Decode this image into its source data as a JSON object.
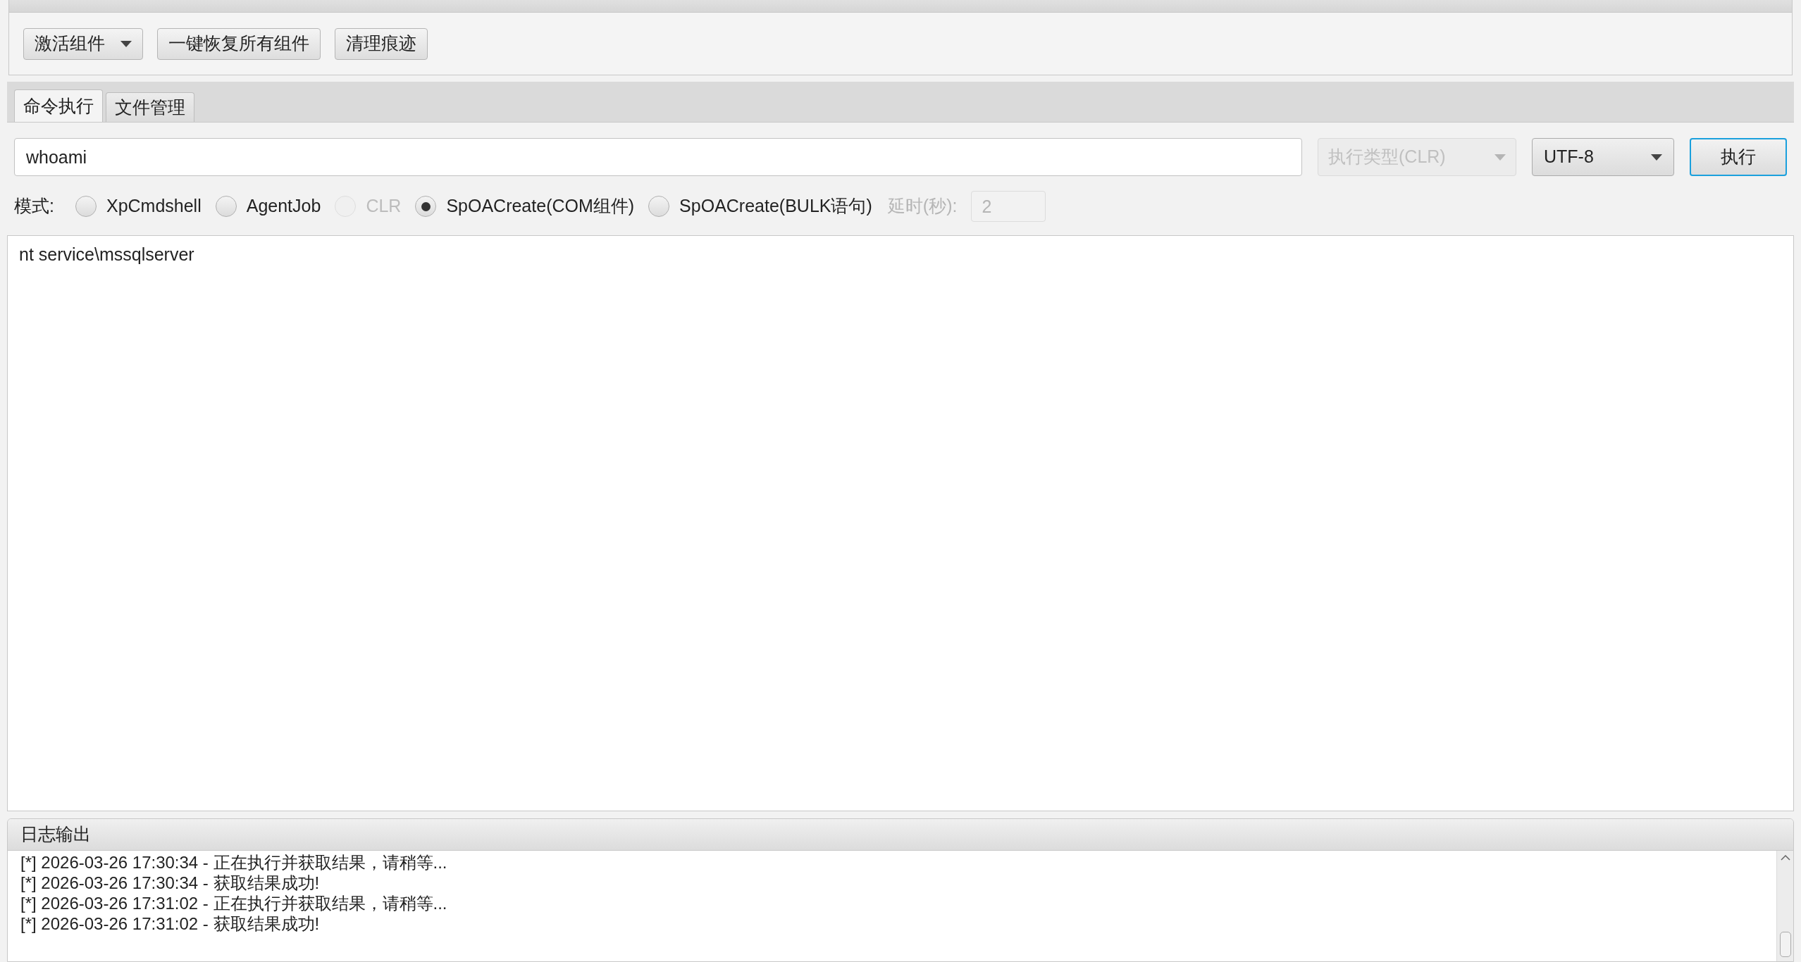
{
  "toolbar": {
    "buttons": [
      {
        "label": "激活组件",
        "kind": "dropdown"
      },
      {
        "label": "一键恢复所有组件",
        "kind": "plain"
      },
      {
        "label": "清理痕迹",
        "kind": "plain"
      }
    ]
  },
  "tabs": [
    {
      "label": "命令执行",
      "selected": true
    },
    {
      "label": "文件管理",
      "selected": false
    }
  ],
  "command": {
    "value": "whoami",
    "exec_type": {
      "label": "执行类型(CLR)",
      "disabled": true
    },
    "encoding": {
      "label": "UTF-8",
      "disabled": false
    },
    "run_button": "执行"
  },
  "mode": {
    "label": "模式:",
    "options": [
      {
        "label": "XpCmdshell",
        "selected": false,
        "disabled": false
      },
      {
        "label": "AgentJob",
        "selected": false,
        "disabled": false
      },
      {
        "label": "CLR",
        "selected": false,
        "disabled": true
      },
      {
        "label": "SpOACreate(COM组件)",
        "selected": true,
        "disabled": false
      },
      {
        "label": "SpOACreate(BULK语句)",
        "selected": false,
        "disabled": false
      }
    ],
    "delay_label": "延时(秒):",
    "delay_value": "2",
    "delay_disabled": true
  },
  "output": "nt service\\mssqlserver",
  "log": {
    "title": "日志输出",
    "lines": [
      "[*] 2026-03-26 17:30:34 - 正在执行并获取结果，请稍等...",
      "[*] 2026-03-26 17:30:34 - 获取结果成功!",
      "[*] 2026-03-26 17:31:02 - 正在执行并获取结果，请稍等...",
      "[*] 2026-03-26 17:31:02 - 获取结果成功!"
    ]
  }
}
